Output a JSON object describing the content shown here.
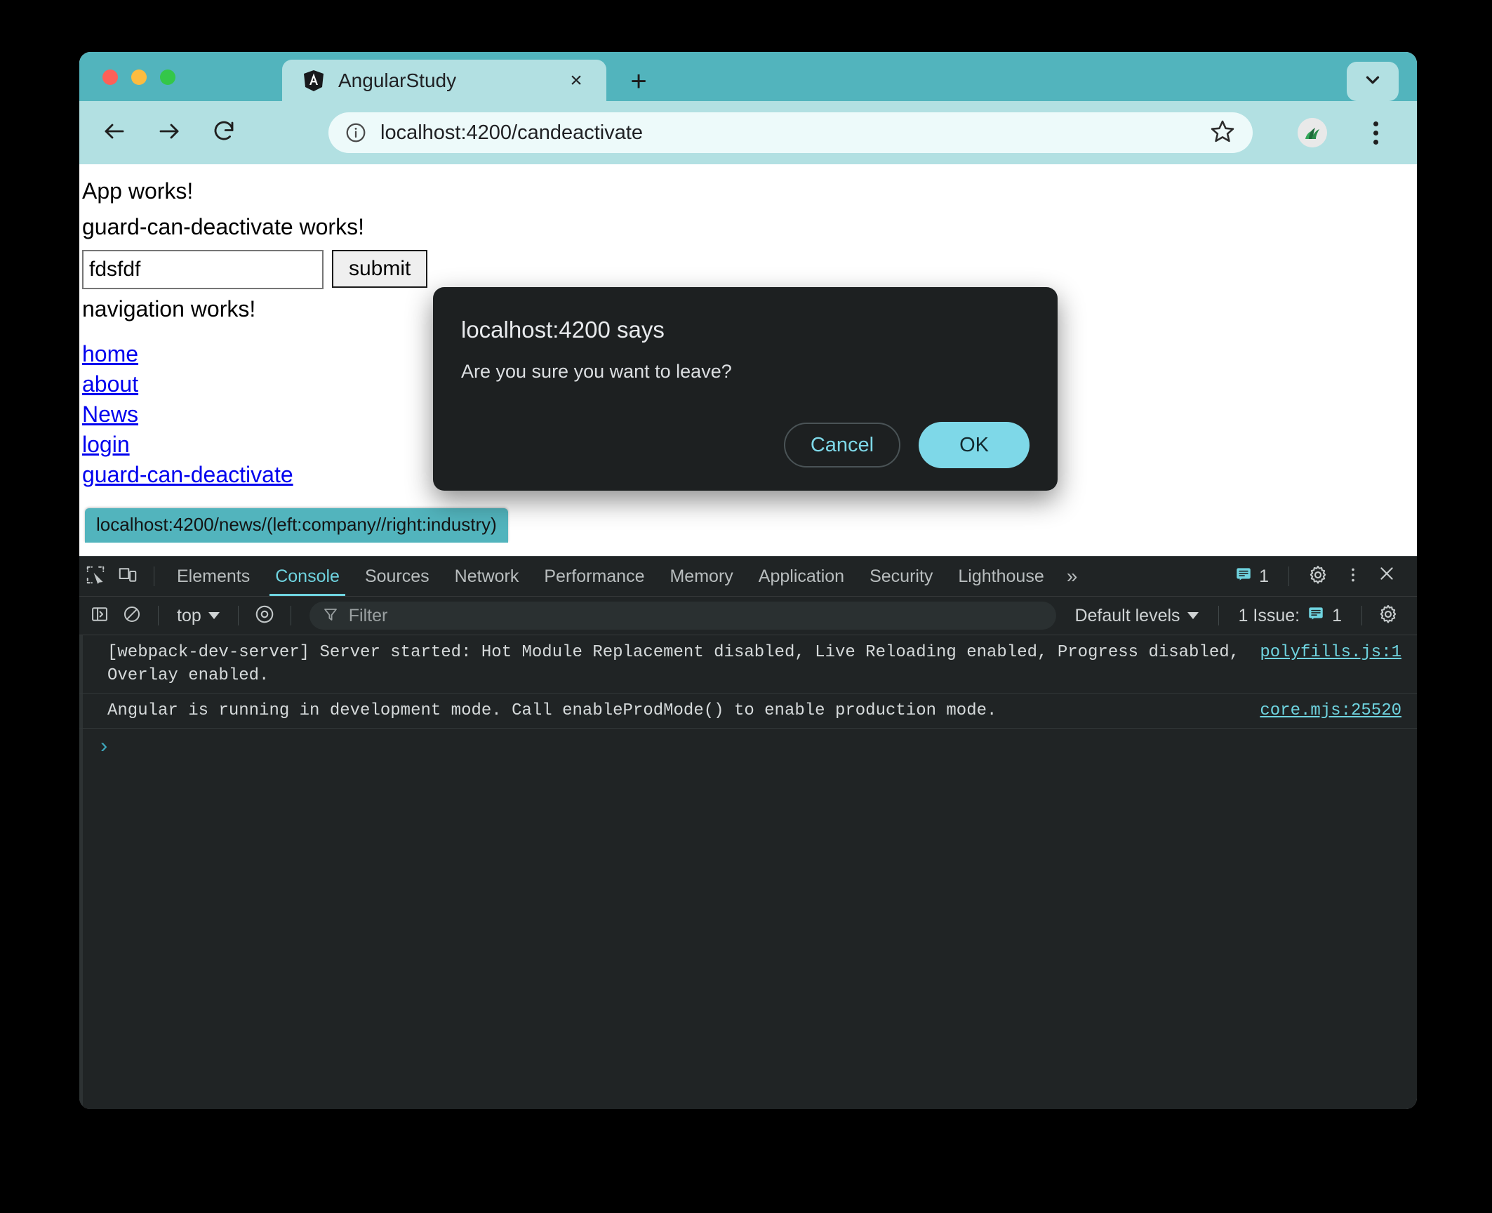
{
  "browser": {
    "tab": {
      "title": "AngularStudy",
      "favicon": "angular-logo-icon",
      "close_label": "×"
    },
    "new_tab_label": "+",
    "tab_search_icon": "chevron-down-icon",
    "toolbar": {
      "back_icon": "back-arrow-icon",
      "forward_icon": "forward-arrow-icon",
      "reload_icon": "reload-icon",
      "info_icon": "info-circle-icon",
      "url": "localhost:4200/candeactivate",
      "star_icon": "star-icon",
      "profile_icon": "extension-avatar-icon",
      "menu_icon": "kebab-menu-icon"
    },
    "accent_color": "#52b4bd",
    "tab_color": "#b2e0e2"
  },
  "page": {
    "lines": [
      "App works!",
      "guard-can-deactivate works!"
    ],
    "input_value": "fdsfdf",
    "input_placeholder": "",
    "submit_label": "submit",
    "nav_text": "navigation works!",
    "links": [
      "home",
      "about",
      "News",
      "login",
      "guard-can-deactivate"
    ],
    "status_tooltip": "localhost:4200/news/(left:company//right:industry)"
  },
  "dialog": {
    "title": "localhost:4200 says",
    "message": "Are you sure you want to leave?",
    "cancel_label": "Cancel",
    "ok_label": "OK",
    "bg_color": "#1d2021",
    "ok_color": "#7ed8e8"
  },
  "devtools": {
    "inspect_icon": "inspect-element-icon",
    "device_icon": "device-toolbar-icon",
    "tabs": [
      {
        "label": "Elements",
        "active": false
      },
      {
        "label": "Console",
        "active": true
      },
      {
        "label": "Sources",
        "active": false
      },
      {
        "label": "Network",
        "active": false
      },
      {
        "label": "Performance",
        "active": false
      },
      {
        "label": "Memory",
        "active": false
      },
      {
        "label": "Application",
        "active": false
      },
      {
        "label": "Security",
        "active": false
      },
      {
        "label": "Lighthouse",
        "active": false
      }
    ],
    "more_tabs_label": "»",
    "issues_badge_count": "1",
    "settings_icon": "gear-icon",
    "more_icon": "kebab-menu-icon",
    "close_icon": "close-icon",
    "console_toolbar": {
      "sidebar_icon": "console-sidebar-icon",
      "clear_icon": "clear-console-icon",
      "context_label": "top",
      "eye_icon": "live-expression-icon",
      "filter_icon": "filter-icon",
      "filter_placeholder": "Filter",
      "levels_label": "Default levels",
      "issues_label": "1 Issue:",
      "issues_count": "1",
      "settings_icon": "gear-icon"
    },
    "logs": [
      {
        "text": "[webpack-dev-server] Server started: Hot Module Replacement disabled, Live Reloading enabled, Progress disabled,\nOverlay enabled.",
        "source": "polyfills.js:1"
      },
      {
        "text": "Angular is running in development mode. Call enableProdMode() to enable production mode.",
        "source": "core.mjs:25520"
      }
    ],
    "prompt_caret": "›",
    "accent_color": "#6fd4e0"
  }
}
